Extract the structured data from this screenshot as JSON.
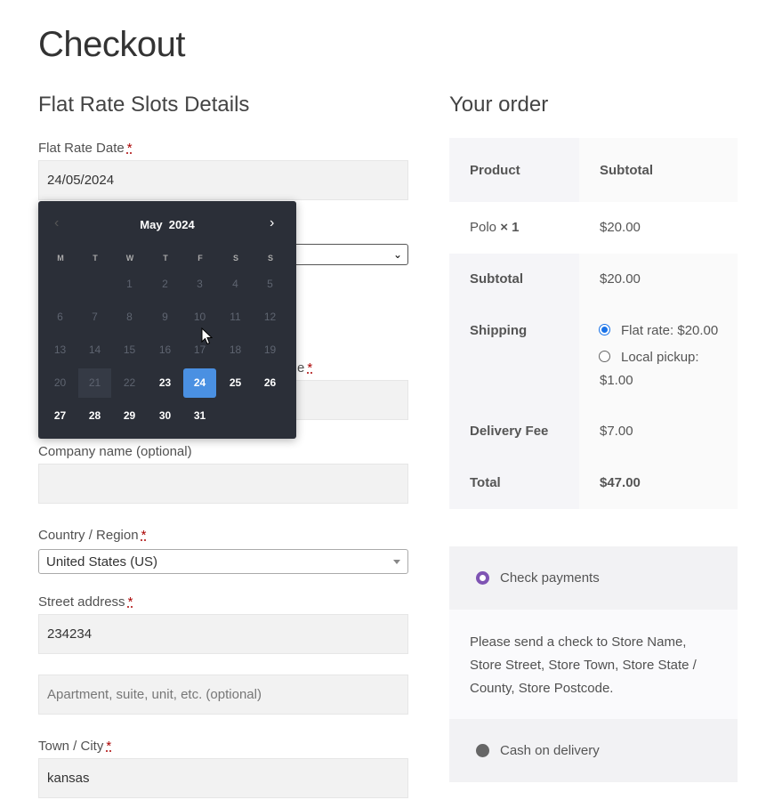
{
  "page": {
    "title": "Checkout"
  },
  "slots": {
    "section_title": "Flat Rate Slots Details",
    "date_label": "Flat Rate Date",
    "date_value": "24/05/2024",
    "hidden_label_tail": "e"
  },
  "billing": {
    "company_label": "Company name (optional)",
    "country_label": "Country / Region",
    "country_value": "United States (US)",
    "street_label": "Street address",
    "street_value": "234234",
    "apartment_placeholder": "Apartment, suite, unit, etc. (optional)",
    "city_label": "Town / City",
    "city_value": "kansas",
    "required_mark": "*"
  },
  "order": {
    "section_title": "Your order",
    "header_product": "Product",
    "header_subtotal": "Subtotal",
    "item_name": "Polo",
    "item_qty": "× 1",
    "item_price": "$20.00",
    "subtotal_label": "Subtotal",
    "subtotal_value": "$20.00",
    "shipping_label": "Shipping",
    "shipping_option_1": "Flat rate: $20.00",
    "shipping_option_2_line1": "Local pickup:",
    "shipping_option_2_line2": "$1.00",
    "fee_label": "Delivery Fee",
    "fee_value": "$7.00",
    "total_label": "Total",
    "total_value": "$47.00"
  },
  "payment": {
    "option_1": "Check payments",
    "option_1_desc": "Please send a check to Store Name, Store Street, Store Town, Store State / County, Store Postcode.",
    "option_2": "Cash on delivery",
    "colors": {
      "selected": "#7f54b3",
      "unselected": "#666666"
    }
  },
  "calendar": {
    "month": "May",
    "year": "2024",
    "prev_icon": "chevron-left-icon",
    "next_icon": "chevron-right-icon",
    "weekdays": [
      "M",
      "T",
      "W",
      "T",
      "F",
      "S",
      "S"
    ],
    "selected_day": "24",
    "accent": "#4a90e2",
    "rows": [
      [
        "",
        "",
        "1",
        "2",
        "3",
        "4",
        "5"
      ],
      [
        "6",
        "7",
        "8",
        "9",
        "10",
        "11",
        "12"
      ],
      [
        "13",
        "14",
        "15",
        "16",
        "17",
        "18",
        "19"
      ],
      [
        "20",
        "21",
        "22",
        "23",
        "24",
        "25",
        "26"
      ],
      [
        "27",
        "28",
        "29",
        "30",
        "31",
        "",
        ""
      ]
    ],
    "enabled_days": [
      "23",
      "24",
      "25",
      "26",
      "27",
      "28",
      "29",
      "30",
      "31"
    ]
  }
}
